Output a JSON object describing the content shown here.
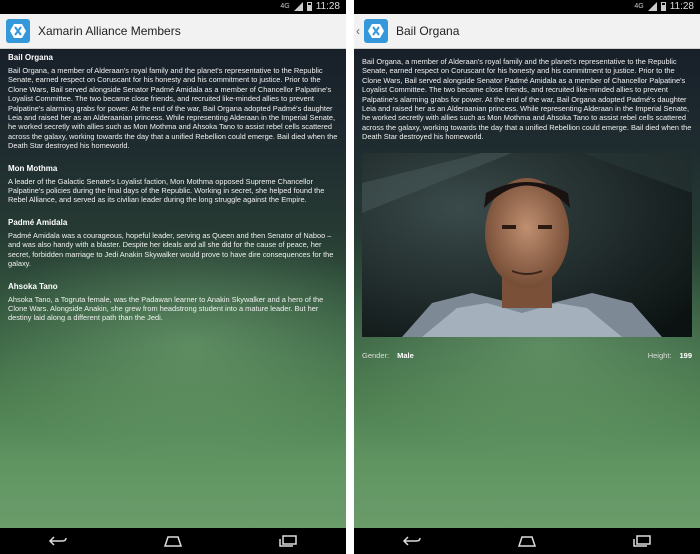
{
  "status_bar": {
    "time": "11:28",
    "network": "4G"
  },
  "left_screen": {
    "title": "Xamarin Alliance Members",
    "members": [
      {
        "name": "Bail Organa",
        "bio": "Bail Organa, a member of Alderaan's royal family and the planet's representative to the Republic Senate, earned respect on Coruscant for his honesty and his commitment to justice. Prior to the Clone Wars, Bail served alongside Senator Padmé Amidala as a member of Chancellor Palpatine's Loyalist Committee. The two became close friends, and recruited like-minded allies to prevent Palpatine's alarming grabs for power. At the end of the war, Bail Organa adopted Padmé's daughter Leia and raised her as an Alderaanian princess. While representing Alderaan in the Imperial Senate, he worked secretly with allies such as Mon Mothma and Ahsoka Tano to assist rebel cells scattered across the galaxy, working towards the day that a unified Rebellion could emerge. Bail died when the Death Star destroyed his homeworld."
      },
      {
        "name": "Mon Mothma",
        "bio": "A leader of the Galactic Senate's Loyalist faction, Mon Mothma opposed Supreme Chancellor Palpatine's policies during the final days of the Republic. Working in secret, she helped found the Rebel Alliance, and served as its civilian leader during the long struggle against the Empire."
      },
      {
        "name": "Padmé Amidala",
        "bio": "Padmé Amidala was a courageous, hopeful leader, serving as Queen and then Senator of Naboo – and was also handy with a blaster. Despite her ideals and all she did for the cause of peace, her secret, forbidden marriage to Jedi Anakin Skywalker would prove to have dire consequences for the galaxy."
      },
      {
        "name": "Ahsoka Tano",
        "bio": "Ahsoka Tano, a Togruta female, was the Padawan learner to Anakin Skywalker and a hero of the Clone Wars. Alongside Anakin, she grew from headstrong student into a mature leader. But her destiny laid along a different path than the Jedi."
      }
    ]
  },
  "right_screen": {
    "title": "Bail Organa",
    "bio": "Bail Organa, a member of Alderaan's royal family and the planet's representative to the Republic Senate, earned respect on Coruscant for his honesty and his commitment to justice. Prior to the Clone Wars, Bail served alongside Senator Padmé Amidala as a member of Chancellor Palpatine's Loyalist Committee. The two became close friends, and recruited like-minded allies to prevent Palpatine's alarming grabs for power. At the end of the war, Bail Organa adopted Padmé's daughter Leia and raised her as an Alderaanian princess. While representing Alderaan in the Imperial Senate, he worked secretly with allies such as Mon Mothma and Ahsoka Tano to assist rebel cells scattered across the galaxy, working towards the day that a unified Rebellion could emerge. Bail died when the Death Star destroyed his homeworld.",
    "gender_label": "Gender:",
    "gender_value": "Male",
    "height_label": "Height:",
    "height_value": "199"
  },
  "icons": {
    "app": "xamarin-logo-icon",
    "back": "back-icon",
    "home": "home-icon",
    "recents": "recents-icon"
  },
  "colors": {
    "accent": "#3498db",
    "action_bar": "#f2f2f2"
  }
}
